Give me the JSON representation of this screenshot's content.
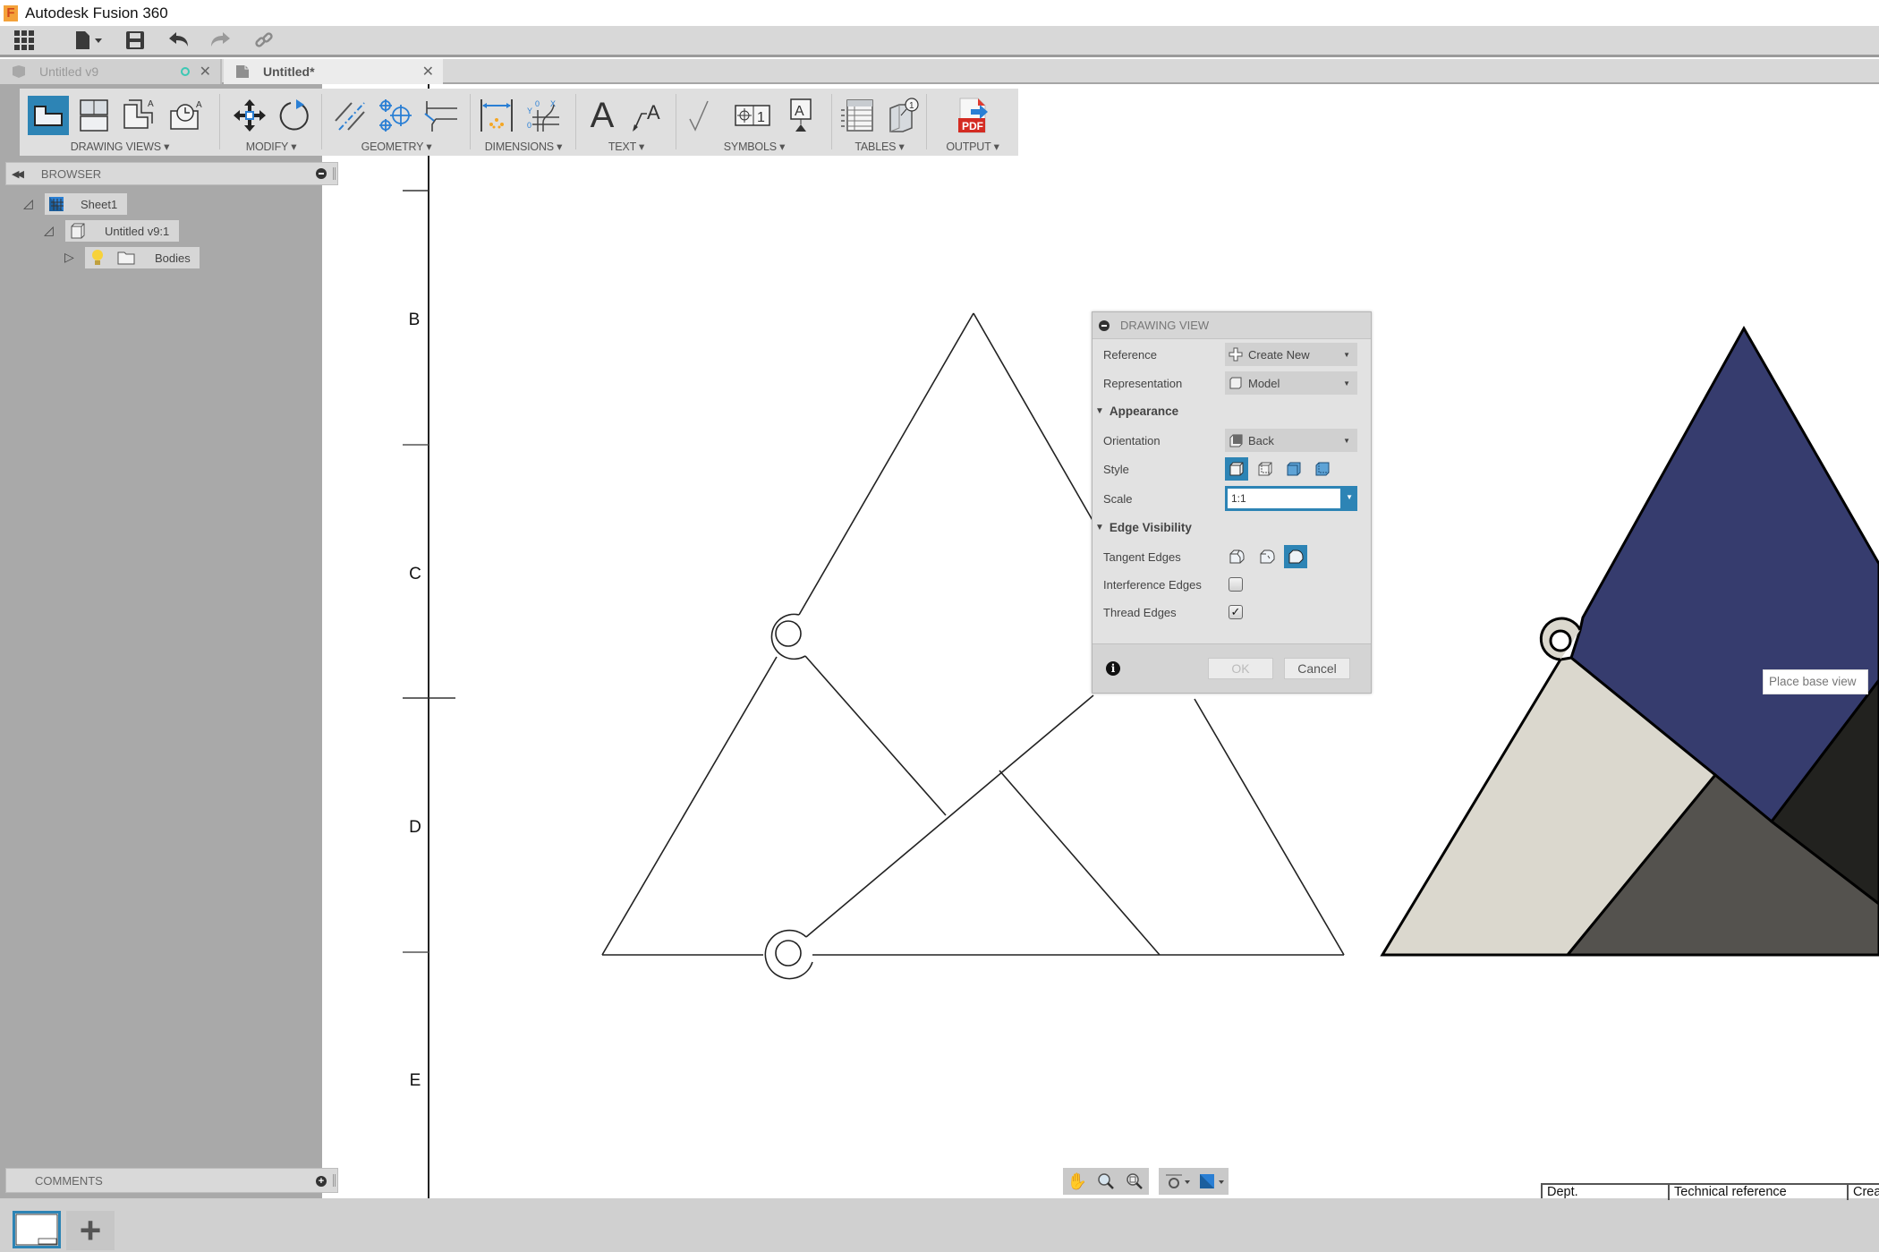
{
  "app": {
    "title": "Autodesk Fusion 360"
  },
  "quick_access": [
    {
      "name": "data-panel-button",
      "icon": "grid-icon"
    },
    {
      "name": "file-menu-button",
      "icon": "file-icon"
    },
    {
      "name": "save-button",
      "icon": "save-icon"
    },
    {
      "name": "undo-button",
      "icon": "undo-icon"
    },
    {
      "name": "redo-button",
      "icon": "redo-icon"
    },
    {
      "name": "link-button",
      "icon": "link-icon"
    }
  ],
  "tabs": [
    {
      "label": "Untitled v9",
      "active": false,
      "status_color": "#3cc8b4"
    },
    {
      "label": "Untitled*",
      "active": true
    }
  ],
  "ribbon": {
    "groups": [
      {
        "label": "DRAWING VIEWS ▾",
        "icons": [
          "base-view-icon",
          "projected-view-icon",
          "section-view-icon",
          "detail-view-icon"
        ]
      },
      {
        "label": "MODIFY ▾",
        "icons": [
          "move-icon",
          "rotate-icon"
        ]
      },
      {
        "label": "GEOMETRY ▾",
        "icons": [
          "centerline-icon",
          "center-mark-icon",
          "edge-extension-icon"
        ]
      },
      {
        "label": "DIMENSIONS ▾",
        "icons": [
          "dimension-icon",
          "ordinate-dimension-icon"
        ]
      },
      {
        "label": "TEXT ▾",
        "icons": [
          "text-icon",
          "leader-icon"
        ]
      },
      {
        "label": "SYMBOLS ▾",
        "icons": [
          "surface-texture-icon",
          "feature-control-frame-icon",
          "datum-identifier-icon"
        ]
      },
      {
        "label": "TABLES ▾",
        "icons": [
          "table-icon",
          "balloon-icon"
        ]
      },
      {
        "label": "OUTPUT ▾",
        "icons": [
          "pdf-export-icon"
        ]
      }
    ]
  },
  "browser": {
    "title": "BROWSER",
    "nodes": [
      {
        "label": "Sheet1",
        "level": 0,
        "expanded": true
      },
      {
        "label": "Untitled v9:1",
        "level": 1,
        "expanded": true
      },
      {
        "label": "Bodies",
        "level": 2,
        "expanded": false
      }
    ]
  },
  "comments": {
    "title": "COMMENTS"
  },
  "sheet_border": {
    "zone_labels": [
      "B",
      "C",
      "D",
      "E"
    ]
  },
  "dialog": {
    "title": "DRAWING VIEW",
    "reference": {
      "label": "Reference",
      "value": "Create New"
    },
    "representation": {
      "label": "Representation",
      "value": "Model"
    },
    "appearance": {
      "label": "Appearance"
    },
    "orientation": {
      "label": "Orientation",
      "value": "Back"
    },
    "style": {
      "label": "Style",
      "selected_index": 0
    },
    "scale": {
      "label": "Scale",
      "value": "1:1"
    },
    "edge_visibility": {
      "label": "Edge Visibility"
    },
    "tangent_edges": {
      "label": "Tangent Edges",
      "selected_index": 2
    },
    "interference_edges": {
      "label": "Interference Edges",
      "checked": false,
      "mark": ""
    },
    "thread_edges": {
      "label": "Thread Edges",
      "checked": true,
      "mark": "✓"
    },
    "ok_label": "OK",
    "cancel_label": "Cancel"
  },
  "tooltip": "Place base view",
  "title_block": {
    "cells": [
      "Dept.",
      "Technical reference",
      "Crea"
    ]
  },
  "colors": {
    "accent": "#2d84b5",
    "preview_blue": "#363c6e",
    "preview_light": "#dbd8ce",
    "preview_mid": "#54524e",
    "preview_dark": "#22221f"
  }
}
